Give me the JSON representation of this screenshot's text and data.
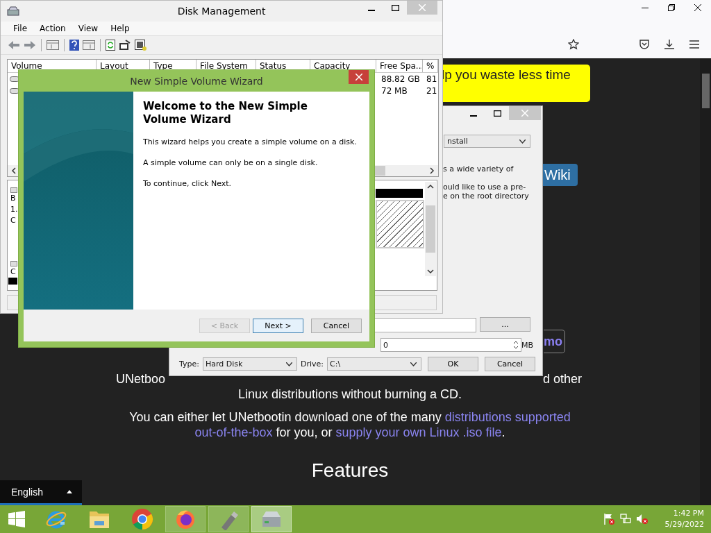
{
  "web_page": {
    "banner": "lp you waste less time",
    "wiki_button": "Wiki",
    "demo_button": "mo",
    "intro_fragments": [
      "UNetboo",
      "d other"
    ],
    "intro_line": "Linux distributions without burning a CD.",
    "paragraph_lines": [
      [
        {
          "text": "You can either let UNetbootin download one of the many ",
          "kind": "text"
        },
        {
          "text": "distributions supported",
          "kind": "link"
        }
      ],
      [
        {
          "text": "out-of-the-box",
          "kind": "link"
        },
        {
          "text": " for you, or ",
          "kind": "text"
        },
        {
          "text": "supply your own Linux .iso file",
          "kind": "link"
        },
        {
          "text": ".",
          "kind": "text"
        }
      ]
    ],
    "heading": "Features"
  },
  "disk_management": {
    "title": "Disk Management",
    "menu": [
      "File",
      "Action",
      "View",
      "Help"
    ],
    "columns": [
      "Volume",
      "Layout",
      "Type",
      "File System",
      "Status",
      "Capacity",
      "Free Spa...",
      "%"
    ],
    "rows": [
      {
        "free_space": "88.82 GB",
        "percent_free": "81"
      },
      {
        "free_space": "72 MB",
        "percent_free": "21"
      }
    ],
    "disk_labels": [
      [
        "B",
        "1.",
        "C"
      ],
      [
        "C"
      ]
    ]
  },
  "unetbootin": {
    "distribution_select": "nstall",
    "description_lines": [
      "s a wide variety of",
      "ould like to use a pre-",
      "e on the root directory"
    ],
    "browse_button": "...",
    "space_value": "0",
    "space_unit": "MB",
    "type_label": "Type:",
    "type_value": "Hard Disk",
    "drive_label": "Drive:",
    "drive_value": "C:\\",
    "buttons": [
      "OK",
      "Cancel"
    ]
  },
  "wizard": {
    "title": "New Simple Volume Wizard",
    "heading": "Welcome to the New Simple Volume Wizard",
    "paragraphs": [
      "This wizard helps you create a simple volume on a disk.",
      "A simple volume can only be on a single disk.",
      "To continue, click Next."
    ],
    "buttons": [
      {
        "label": "< Back",
        "disabled": true,
        "default": false
      },
      {
        "label": "Next >",
        "disabled": false,
        "default": true
      },
      {
        "label": "Cancel",
        "disabled": false,
        "default": false
      }
    ]
  },
  "language_bar": {
    "label": "English"
  },
  "taskbar": {
    "apps": [
      {
        "kind": "ie",
        "open": false,
        "selected": false
      },
      {
        "kind": "explorer",
        "open": false,
        "selected": false
      },
      {
        "kind": "chrome",
        "open": false,
        "selected": false
      },
      {
        "kind": "firefox",
        "open": true,
        "selected": false
      },
      {
        "kind": "usb",
        "open": true,
        "selected": false
      },
      {
        "kind": "disk",
        "open": true,
        "selected": true
      }
    ],
    "tray": [
      {
        "kind": "flag"
      },
      {
        "kind": "network"
      },
      {
        "kind": "speaker"
      }
    ],
    "time": "1:42 PM",
    "date": "5/29/2022"
  }
}
